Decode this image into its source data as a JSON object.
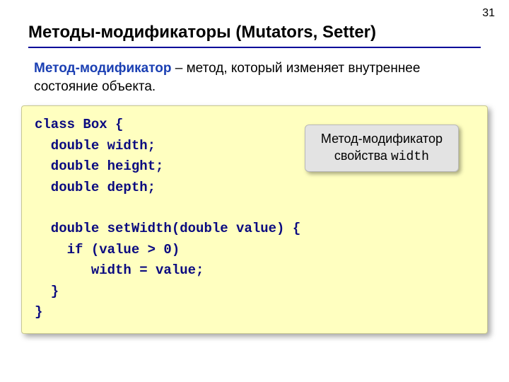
{
  "page_number": "31",
  "title": "Методы-модификаторы (Mutators, Setter)",
  "definition": {
    "term": "Метод-модификатор",
    "rest": " – метод, который изменяет внутреннее состояние объекта."
  },
  "code": "class Box {\n  double width;\n  double height;\n  double depth;\n\n  double setWidth(double value) {\n    if (value > 0)\n       width = value;\n  }\n}",
  "callout": {
    "line1": "Метод-модификатор",
    "line2_prefix": "свойства ",
    "line2_mono": "width"
  }
}
